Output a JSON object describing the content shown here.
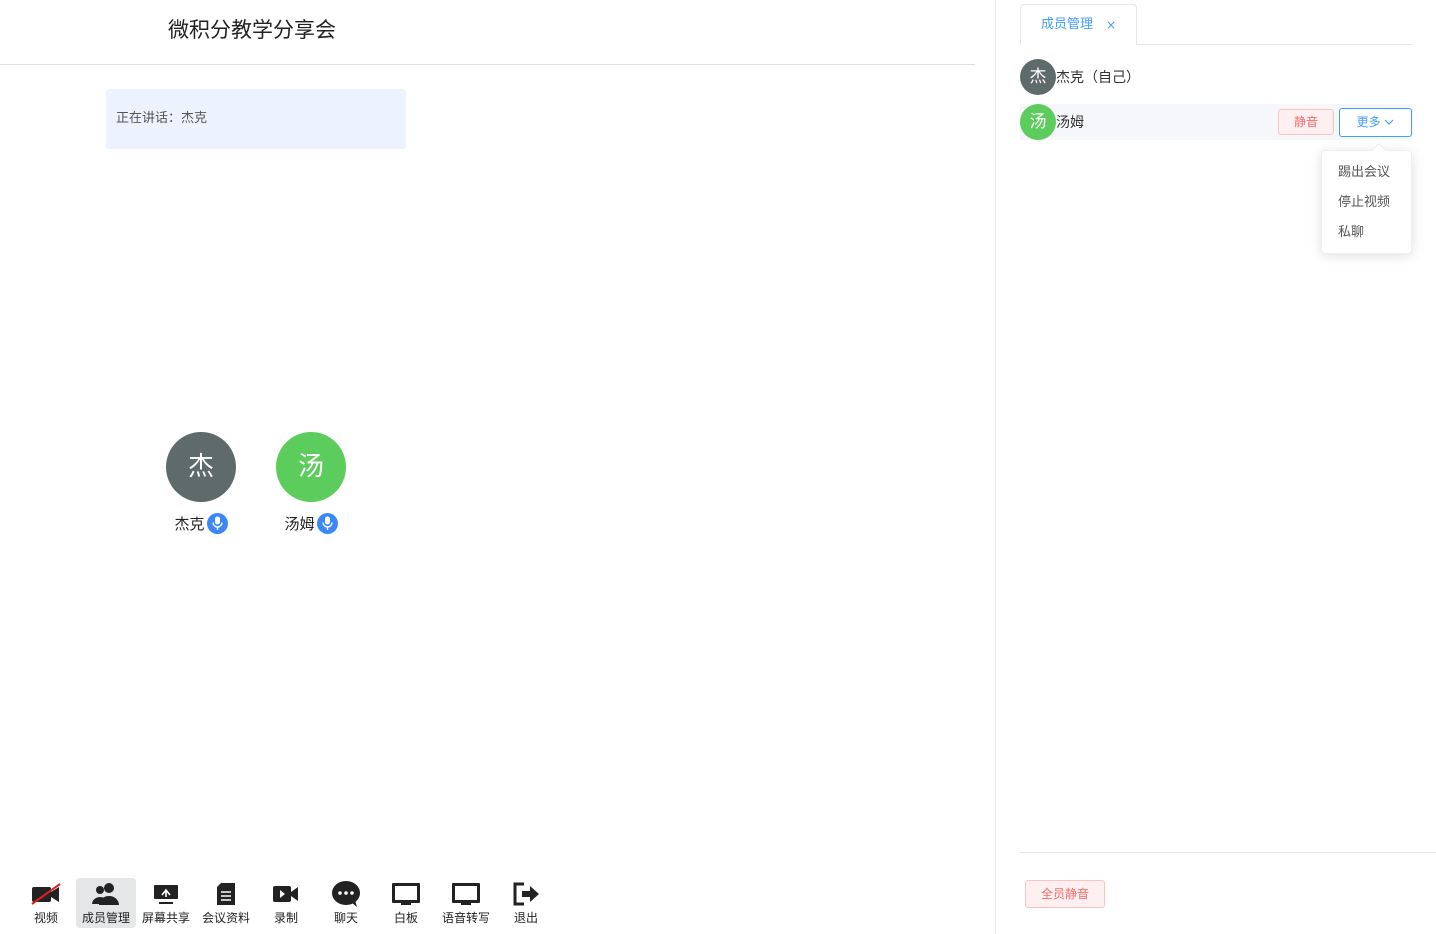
{
  "header": {
    "title": "微积分教学分享会"
  },
  "speaking": {
    "text": "正在讲话：杰克"
  },
  "tiles": [
    {
      "initial": "杰",
      "name": "杰克",
      "color": "#5f6b6b"
    },
    {
      "initial": "汤",
      "name": "汤姆",
      "color": "#5ccc5c"
    }
  ],
  "toolbar": [
    {
      "label": "视频",
      "icon": "video-off-icon"
    },
    {
      "label": "成员管理",
      "icon": "members-icon",
      "active": true
    },
    {
      "label": "屏幕共享",
      "icon": "screen-share-icon"
    },
    {
      "label": "会议资料",
      "icon": "document-icon"
    },
    {
      "label": "录制",
      "icon": "record-icon"
    },
    {
      "label": "聊天",
      "icon": "chat-icon"
    },
    {
      "label": "白板",
      "icon": "whiteboard-icon"
    },
    {
      "label": "语音转写",
      "icon": "transcribe-icon"
    },
    {
      "label": "退出",
      "icon": "exit-icon"
    }
  ],
  "panel": {
    "tab_label": "成员管理",
    "tab_close": "×",
    "members": [
      {
        "initial": "杰",
        "name": "杰克（自己）",
        "color": "#5f6b6b"
      },
      {
        "initial": "汤",
        "name": "汤姆",
        "color": "#5ccc5c",
        "mute_label": "静音",
        "more_label": "更多"
      }
    ],
    "dropdown": [
      "踢出会议",
      "停止视频",
      "私聊"
    ],
    "mute_all_label": "全员静音"
  }
}
